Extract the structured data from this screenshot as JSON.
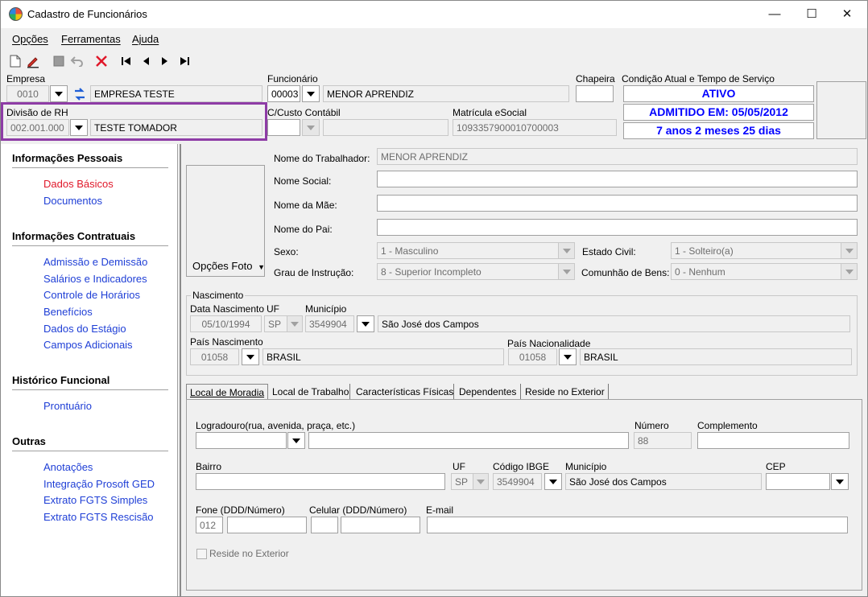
{
  "window": {
    "title": "Cadastro de Funcionários",
    "minimize": "—",
    "maximize": "☐",
    "close": "✕"
  },
  "menu": [
    "Opções",
    "Ferramentas",
    "Ajuda"
  ],
  "header": {
    "empresa_label": "Empresa",
    "empresa_code": "0010",
    "empresa_name": "EMPRESA TESTE",
    "divisao_label": "Divisão de RH",
    "divisao_code": "002.001.000",
    "divisao_name": "TESTE TOMADOR",
    "funcionario_label": "Funcionário",
    "funcionario_code": "00003",
    "funcionario_name": "MENOR APRENDIZ",
    "chapeira_label": "Chapeira",
    "chapeira_value": "",
    "custo_label": "C/Custo Contábil",
    "custo_value": "",
    "matricula_label": "Matrícula eSocial",
    "matricula_value": "1093357900010700003",
    "condicao_label": "Condição Atual e Tempo de Serviço",
    "status": "ATIVO",
    "admitido": "ADMITIDO EM: 05/05/2012",
    "tempo": "7 anos 2 meses 25 dias"
  },
  "sidebar": {
    "sections": [
      {
        "title": "Informações Pessoais",
        "items": [
          "Dados Básicos",
          "Documentos"
        ]
      },
      {
        "title": "Informações Contratuais",
        "items": [
          "Admissão e Demissão",
          "Salários e Indicadores",
          "Controle de Horários",
          "Benefícios",
          "Dados do Estágio",
          "Campos Adicionais"
        ]
      },
      {
        "title": "Histórico Funcional",
        "items": [
          "Prontuário"
        ]
      },
      {
        "title": "Outras",
        "items": [
          "Anotações",
          "Integração Prosoft GED",
          "Extrato FGTS Simples",
          "Extrato FGTS Rescisão"
        ]
      }
    ]
  },
  "basic": {
    "photo_button": "Opções Foto",
    "nome_label": "Nome do Trabalhador:",
    "nome_value": "MENOR APRENDIZ",
    "social_label": "Nome Social:",
    "mae_label": "Nome da Mãe:",
    "pai_label": "Nome do Pai:",
    "sexo_label": "Sexo:",
    "sexo_value": "1 - Masculino",
    "civil_label": "Estado Civil:",
    "civil_value": "1 - Solteiro(a)",
    "grau_label": "Grau de Instrução:",
    "grau_value": "8 - Superior Incompleto",
    "comunhao_label": "Comunhão de Bens:",
    "comunhao_value": "0 - Nenhum"
  },
  "nascimento": {
    "legend": "Nascimento",
    "data_label": "Data Nascimento",
    "data_value": "05/10/1994",
    "uf_label": "UF",
    "uf_value": "SP",
    "mun_label": "Município",
    "mun_code": "3549904",
    "mun_name": "São José dos Campos",
    "pais_nasc_label": "País Nascimento",
    "pais_nasc_code": "01058",
    "pais_nasc_name": "BRASIL",
    "pais_nac_label": "País Nacionalidade",
    "pais_nac_code": "01058",
    "pais_nac_name": "BRASIL"
  },
  "tabs": [
    "Local de Moradia",
    "Local de Trabalho",
    "Características Físicas",
    "Dependentes",
    "Reside no Exterior"
  ],
  "moradia": {
    "logradouro_label": "Logradouro(rua, avenida, praça, etc.)",
    "numero_label": "Número",
    "numero_value": "88",
    "complemento_label": "Complemento",
    "bairro_label": "Bairro",
    "uf_label": "UF",
    "uf_value": "SP",
    "ibge_label": "Código IBGE",
    "ibge_value": "3549904",
    "mun_label": "Município",
    "mun_value": "São José dos Campos",
    "cep_label": "CEP",
    "fone_label": "Fone (DDD/Número)",
    "fone_ddd": "012",
    "celular_label": "Celular (DDD/Número)",
    "email_label": "E-mail",
    "exterior_label": "Reside no Exterior"
  }
}
